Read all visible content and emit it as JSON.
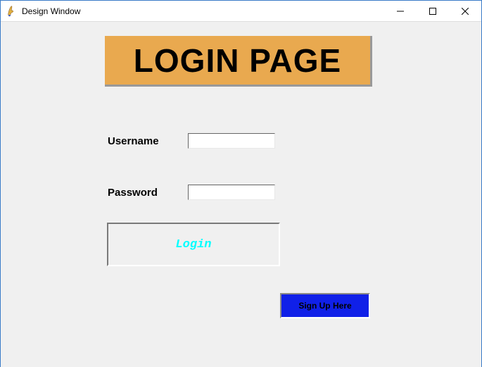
{
  "window": {
    "title": "Design Window"
  },
  "main": {
    "heading": "LOGIN PAGE",
    "username_label": "Username",
    "password_label": "Password",
    "username_value": "",
    "password_value": "",
    "login_button_label": "Login",
    "signup_button_label": "Sign Up Here"
  }
}
